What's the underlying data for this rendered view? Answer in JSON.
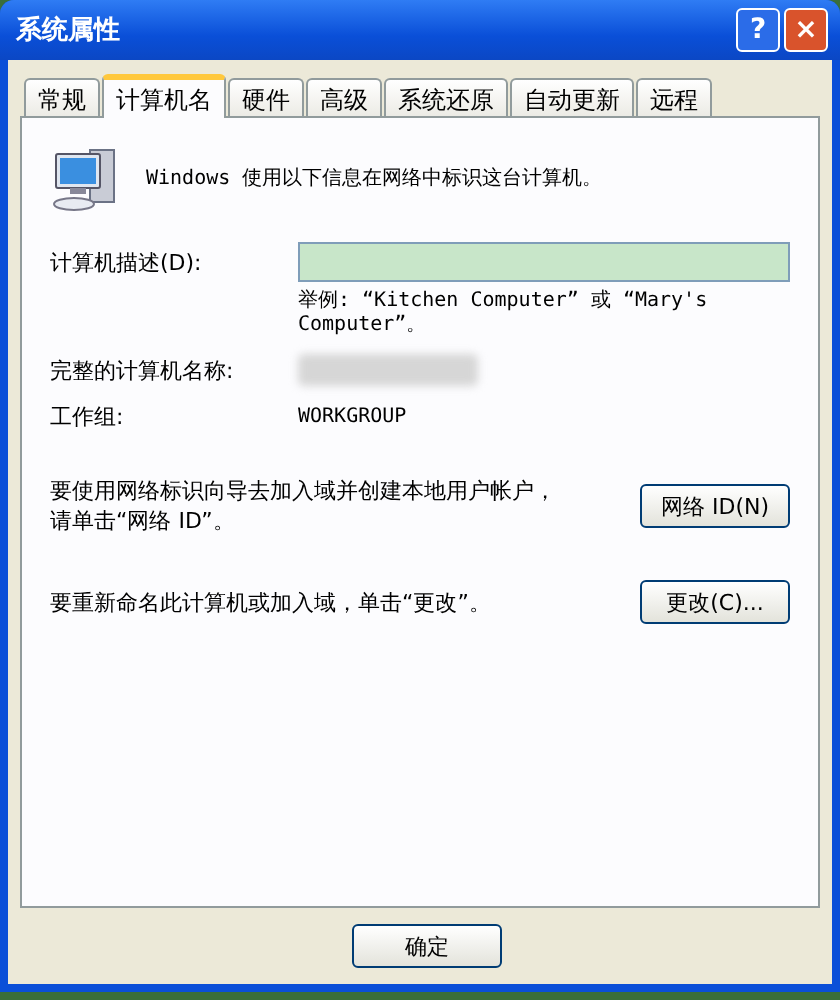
{
  "window": {
    "title": "系统属性",
    "help_label": "?",
    "close_label": "×"
  },
  "tabs": [
    {
      "label": "常规",
      "selected": false
    },
    {
      "label": "计算机名",
      "selected": true
    },
    {
      "label": "硬件",
      "selected": false
    },
    {
      "label": "高级",
      "selected": false
    },
    {
      "label": "系统还原",
      "selected": false
    },
    {
      "label": "自动更新",
      "selected": false
    },
    {
      "label": "远程",
      "selected": false
    }
  ],
  "intro": "Windows 使用以下信息在网络中标识这台计算机。",
  "description": {
    "label": "计算机描述(D):",
    "example": "举例: “Kitchen Computer” 或 “Mary's Computer”。"
  },
  "full_name": {
    "label": "完整的计算机名称:"
  },
  "workgroup": {
    "label": "工作组:",
    "value": "WORKGROUP"
  },
  "network_id": {
    "text": "要使用网络标识向导去加入域并创建本地用户帐户，请单击“网络 ID”。",
    "button": "网络 ID(N)"
  },
  "rename": {
    "text": "要重新命名此计算机或加入域，单击“更改”。",
    "button": "更改(C)..."
  },
  "buttons": [
    "确定"
  ]
}
